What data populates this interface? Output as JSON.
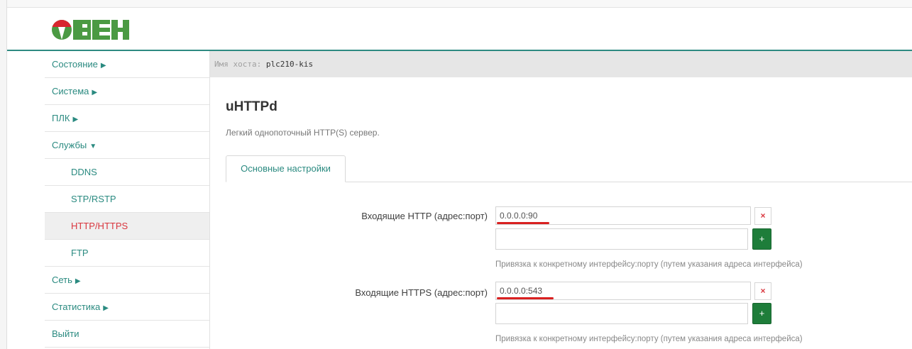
{
  "colors": {
    "accent": "#2a8a80",
    "active": "#d9363e",
    "header_border": "#2e8a82",
    "add_button": "#1e7d3a"
  },
  "brand": {
    "logo_text": "ОВЕН"
  },
  "sidebar": {
    "items": [
      {
        "label": "Состояние",
        "arrow": "▶"
      },
      {
        "label": "Система",
        "arrow": "▶"
      },
      {
        "label": "ПЛК",
        "arrow": "▶"
      },
      {
        "label": "Службы",
        "arrow": "▼"
      },
      {
        "label": "DDNS"
      },
      {
        "label": "STP/RSTP"
      },
      {
        "label": "HTTP/HTTPS"
      },
      {
        "label": "FTP"
      },
      {
        "label": "Сеть",
        "arrow": "▶"
      },
      {
        "label": "Статистика",
        "arrow": "▶"
      },
      {
        "label": "Выйти"
      }
    ]
  },
  "hostbar": {
    "label": "Имя хоста:",
    "value": "plc210-kis"
  },
  "page": {
    "title": "uHTTPd",
    "description": "Легкий однопоточный HTTP(S) сервер.",
    "tabs": [
      {
        "label": "Основные настройки"
      }
    ]
  },
  "form": {
    "http": {
      "label": "Входящие HTTP (адрес:порт)",
      "value": "0.0.0.0:90",
      "new_value": "",
      "remove_icon": "×",
      "add_icon": "+",
      "hint": "Привязка к конкретному интерфейсу:порту (путем указания адреса интерфейса)"
    },
    "https": {
      "label": "Входящие HTTPS (адрес:порт)",
      "value": "0.0.0.0:543",
      "new_value": "",
      "remove_icon": "×",
      "add_icon": "+",
      "hint": "Привязка к конкретному интерфейсу:порту (путем указания адреса интерфейса)"
    }
  }
}
